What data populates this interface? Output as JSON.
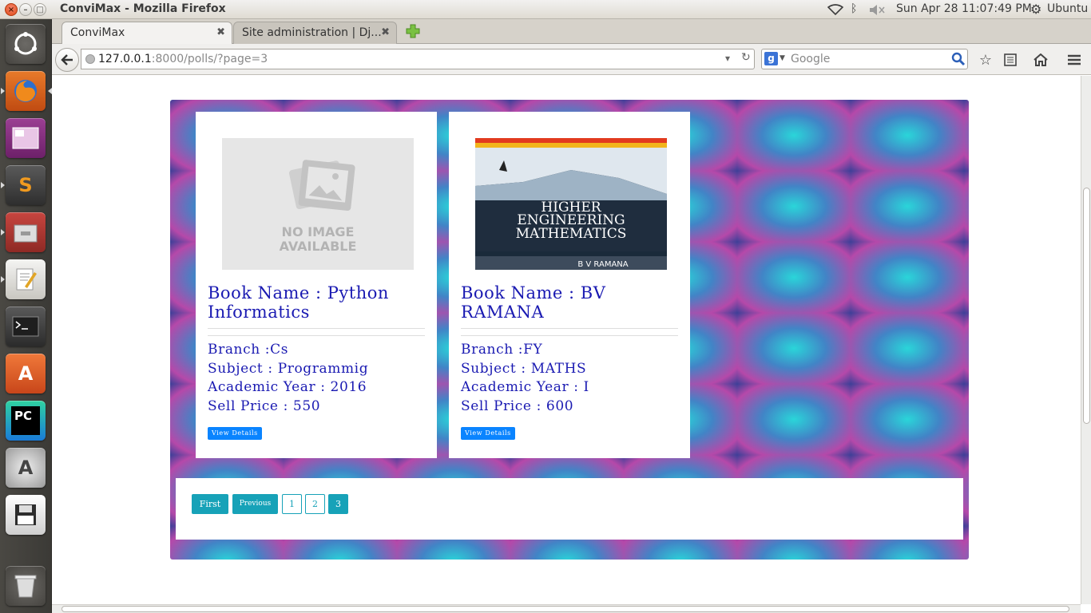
{
  "window": {
    "title": "ConviMax - Mozilla Firefox"
  },
  "panel": {
    "datetime": "Sun Apr 28 11:07:49 PM",
    "user": "Ubuntu"
  },
  "tabs": [
    {
      "label": "ConviMax"
    },
    {
      "label": "Site administration | Dj..."
    }
  ],
  "navbar": {
    "url_host": "127.0.0.1",
    "url_rest": ":8000/polls/?page=3",
    "search_placeholder": "Google"
  },
  "books": [
    {
      "image_text_1": "NO IMAGE",
      "image_text_2": "AVAILABLE",
      "title": "Book Name : Python Informatics",
      "branch": "Branch :Cs",
      "subject": "Subject : Programmig",
      "year": "Academic Year : 2016",
      "price": "Sell Price : 550",
      "button": "View Details"
    },
    {
      "image_text_1": "HIGHER",
      "image_text_2": "ENGINEERING",
      "image_text_3": "MATHEMATICS",
      "image_author": "B V RAMANA",
      "title": "Book Name : BV RAMANA",
      "branch": "Branch :FY",
      "subject": "Subject : MATHS",
      "year": "Academic Year : I",
      "price": "Sell Price : 600",
      "button": "View Details"
    }
  ],
  "pagination": {
    "first": "First",
    "previous": "Previous",
    "pages": [
      "1",
      "2",
      "3"
    ],
    "current": "3"
  },
  "colors": {
    "link_text": "#1a1ab2",
    "button_blue": "#0a84ff",
    "pager_teal": "#17a2b8"
  }
}
